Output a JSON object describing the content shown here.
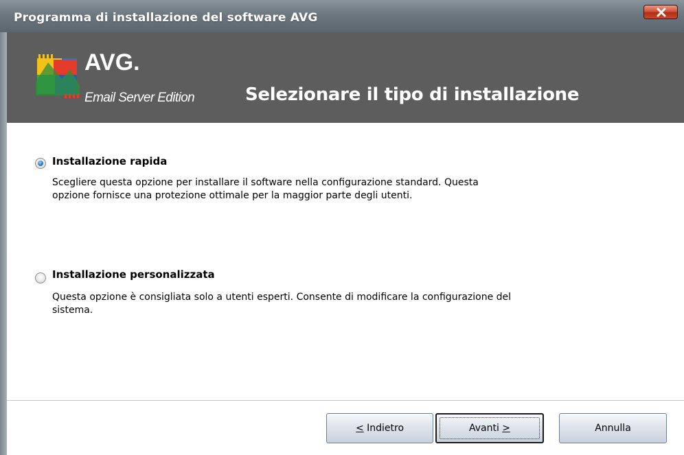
{
  "window": {
    "title": "Programma di installazione del software AVG"
  },
  "header": {
    "logo_brand": "AVG.",
    "logo_edition": "Email Server Edition",
    "title": "Selezionare il tipo di installazione"
  },
  "options": [
    {
      "label": "Installazione rapida",
      "description": "Scegliere questa opzione per installare il software nella configurazione standard. Questa opzione fornisce una protezione ottimale per la maggior parte degli utenti.",
      "selected": true
    },
    {
      "label": "Installazione personalizzata",
      "description": "Questa opzione è consigliata solo a utenti esperti. Consente di modificare la configurazione del sistema.",
      "selected": false
    }
  ],
  "buttons": {
    "back_label": "< Indietro",
    "back_prefix": "<",
    "back_text": " Indietro",
    "next_text": "Avanti ",
    "next_suffix": ">",
    "cancel_label": "Annulla"
  },
  "icons": {
    "close": "close-icon",
    "logo": "avg-logo-icon"
  },
  "colors": {
    "titlebar": "#6d7780",
    "header_bg": "#5d5d5d",
    "close_button": "#c64a2c",
    "radio_selected": "#2b79c9"
  }
}
